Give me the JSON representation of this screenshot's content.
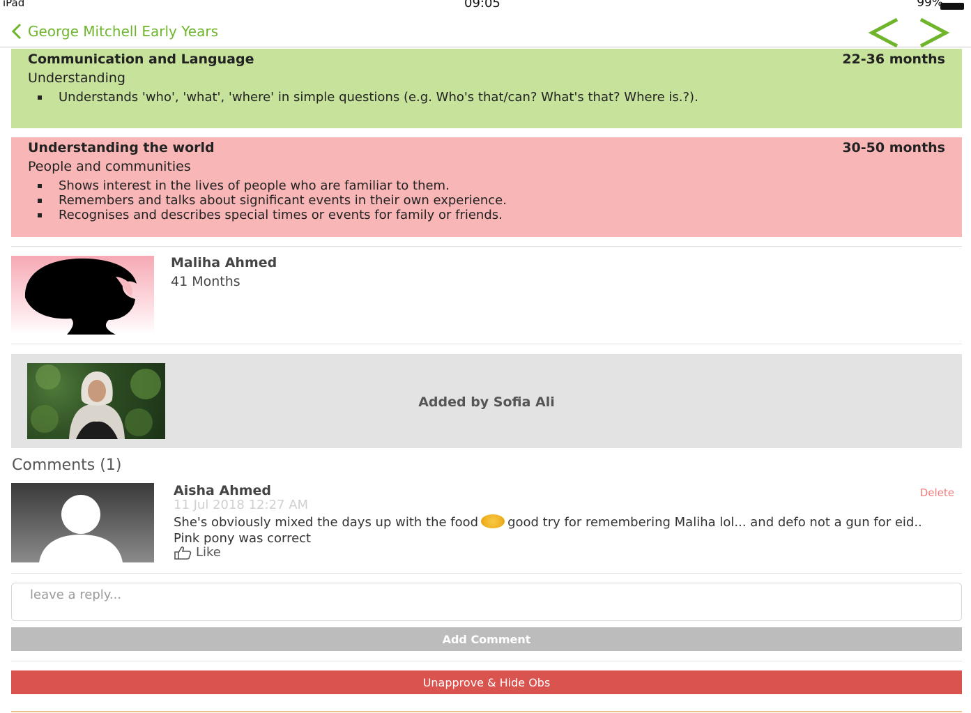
{
  "status_bar": {
    "device": "iPad",
    "time": "09:05",
    "battery": "99%"
  },
  "nav": {
    "back_label": "George Mitchell Early Years",
    "accent_color": "#6fb52c"
  },
  "panels": [
    {
      "area": "Communication and Language",
      "age_range": "22-36 months",
      "aspect": "Understanding",
      "statements": [
        "Understands 'who', 'what', 'where' in simple questions (e.g. Who's that/can? What's that? Where is.?)."
      ],
      "color": "#c6e29b"
    },
    {
      "area": "Understanding the world",
      "age_range": "30-50 months",
      "aspect": "People and communities",
      "statements": [
        "Shows interest in the lives of people who are familiar to them.",
        "Remembers and talks about significant events in their own experience.",
        "Recognises and describes special times or events for family or friends."
      ],
      "color": "#f9b6b6"
    }
  ],
  "child": {
    "name": "Maliha Ahmed",
    "age": "41 Months"
  },
  "added_by": {
    "text": "Added by Sofia Ali"
  },
  "comments": {
    "heading": "Comments (1)",
    "items": [
      {
        "author": "Aisha Ahmed",
        "date": "11 Jul 2018 12:27 AM",
        "text_before_emoji": "She's obviously mixed the days up with the food",
        "text_after_emoji": "good try for remembering Maliha lol... and defo not a gun for eid.. Pink pony was correct",
        "like_label": "Like",
        "delete_label": "Delete"
      }
    ]
  },
  "reply": {
    "placeholder": "leave a reply..."
  },
  "buttons": {
    "add_comment": "Add Comment",
    "unapprove": "Unapprove & Hide Obs"
  }
}
